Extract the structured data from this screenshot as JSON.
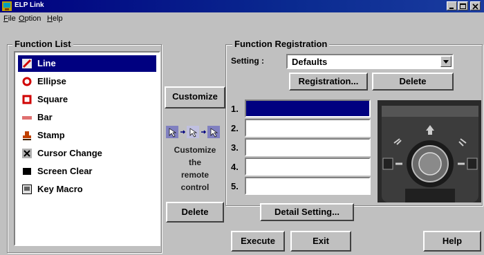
{
  "window": {
    "title": "ELP Link"
  },
  "menu": [
    {
      "label": "File",
      "u": "F",
      "rest": "ile"
    },
    {
      "label": "Option",
      "u": "O",
      "rest": "ption"
    },
    {
      "label": "Help",
      "u": "H",
      "rest": "elp"
    }
  ],
  "function_list": {
    "title": "Function List",
    "items": [
      {
        "label": "Line",
        "icon": "line-icon",
        "selected": true
      },
      {
        "label": "Ellipse",
        "icon": "ellipse-icon"
      },
      {
        "label": "Square",
        "icon": "square-icon"
      },
      {
        "label": "Bar",
        "icon": "bar-icon"
      },
      {
        "label": "Stamp",
        "icon": "stamp-icon"
      },
      {
        "label": "Cursor Change",
        "icon": "cursor-change-icon"
      },
      {
        "label": "Screen Clear",
        "icon": "screen-clear-icon"
      },
      {
        "label": "Key Macro",
        "icon": "key-macro-icon"
      }
    ]
  },
  "middle": {
    "customize_label": "Customize",
    "hint_lines": [
      "Customize",
      "the",
      "remote",
      "control"
    ],
    "delete_label": "Delete"
  },
  "registration": {
    "title": "Function Registration",
    "setting_label": "Setting :",
    "setting_value": "Defaults",
    "registration_button": "Registration...",
    "delete_button": "Delete",
    "slots": [
      "1.",
      "2.",
      "3.",
      "4.",
      "5."
    ],
    "detail_button": "Detail Setting..."
  },
  "footer": {
    "execute": "Execute",
    "exit": "Exit",
    "help": "Help"
  },
  "colors": {
    "titlebar": "#000080",
    "selection": "#000080",
    "face": "#c0c0c0"
  }
}
